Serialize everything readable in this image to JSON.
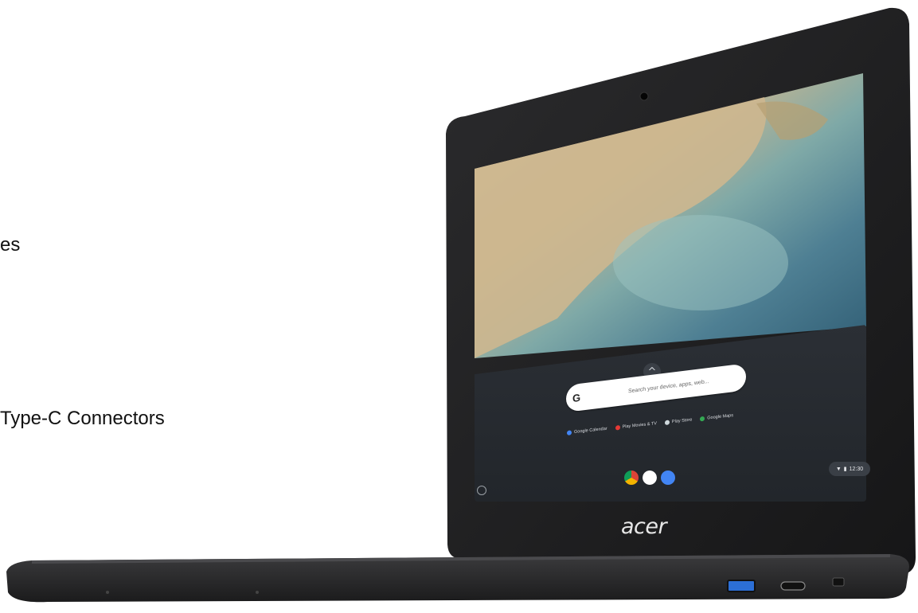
{
  "left_text": {
    "line1": "es",
    "line2": "Type-C Connectors"
  },
  "screen": {
    "search_placeholder": "Search your device, apps, web...",
    "search_logo": "G",
    "chevron": "^",
    "suggestions": [
      {
        "label": "Google Calendar",
        "color": "#4285f4"
      },
      {
        "label": "Play Movies & TV",
        "color": "#e53935"
      },
      {
        "label": "Play Store",
        "color": "#cfd8dc"
      },
      {
        "label": "Google Maps",
        "color": "#34a853"
      }
    ],
    "shelf_apps": [
      "chrome-icon",
      "play-store-icon",
      "files-icon"
    ],
    "clock": "12:30"
  },
  "brand": "acer"
}
